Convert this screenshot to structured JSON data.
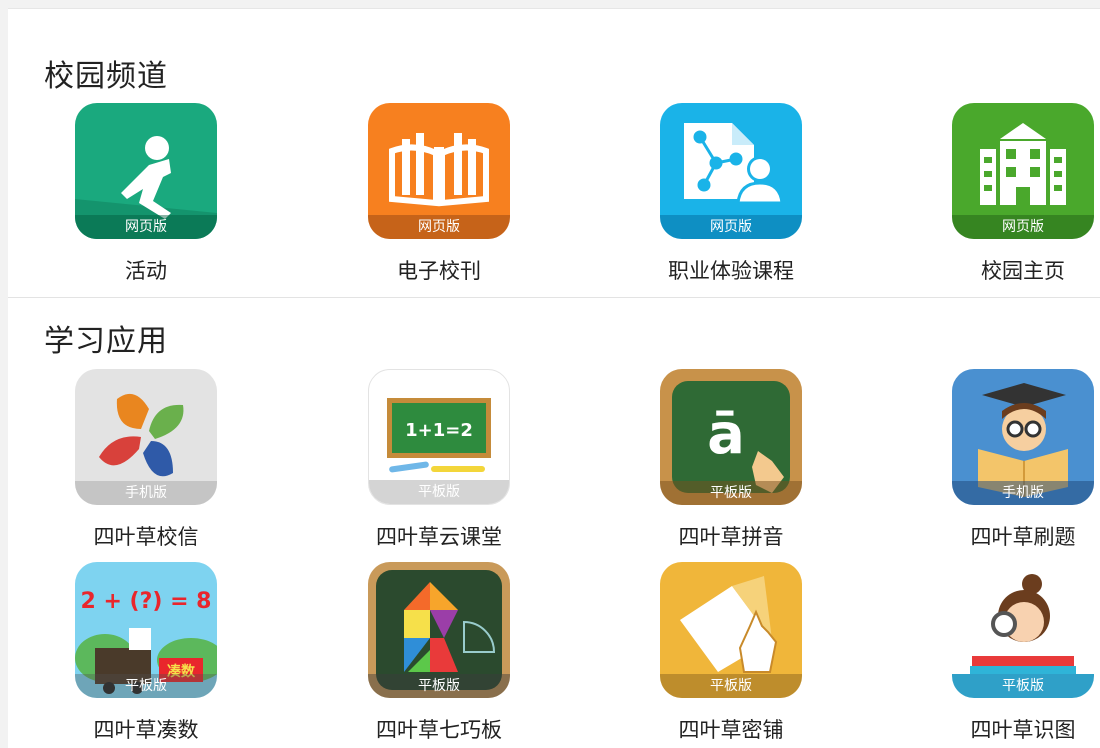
{
  "sections": [
    {
      "title": "校园频道",
      "apps": [
        {
          "label": "活动",
          "badge": "网页版",
          "icon": "running-person-icon",
          "color": "#1aa97e"
        },
        {
          "label": "电子校刊",
          "badge": "网页版",
          "icon": "open-book-icon",
          "color": "#f7801f"
        },
        {
          "label": "职业体验课程",
          "badge": "网页版",
          "icon": "career-document-icon",
          "color": "#1ab3e8"
        },
        {
          "label": "校园主页",
          "badge": "网页版",
          "icon": "school-building-icon",
          "color": "#4aa82c"
        }
      ]
    },
    {
      "title": "学习应用",
      "apps": [
        {
          "label": "四叶草校信",
          "badge": "手机版",
          "icon": "clover-icon",
          "color": "#e3e3e3"
        },
        {
          "label": "四叶草云课堂",
          "badge": "平板版",
          "icon": "chalkboard-icon",
          "color": "#ffffff"
        },
        {
          "label": "四叶草拼音",
          "badge": "平板版",
          "icon": "pinyin-board-icon",
          "color": "#2f6a35"
        },
        {
          "label": "四叶草刷题",
          "badge": "手机版",
          "icon": "graduate-reading-icon",
          "color": "#4a90d0"
        },
        {
          "label": "四叶草凑数",
          "badge": "平板版",
          "icon": "math-train-icon",
          "color": "#7ed3f0"
        },
        {
          "label": "四叶草七巧板",
          "badge": "平板版",
          "icon": "tangram-icon",
          "color": "#2b4a2e"
        },
        {
          "label": "四叶草密铺",
          "badge": "平板版",
          "icon": "tiling-icon",
          "color": "#f0b63a"
        },
        {
          "label": "四叶草识图",
          "badge": "平板版",
          "icon": "girl-magnifier-icon",
          "color": "#ffffff"
        }
      ],
      "math_text": "2 + (?) = 8",
      "chalk_text": "1+1=2",
      "pinyin_letter": "ā",
      "train_sign": "凑数"
    }
  ]
}
